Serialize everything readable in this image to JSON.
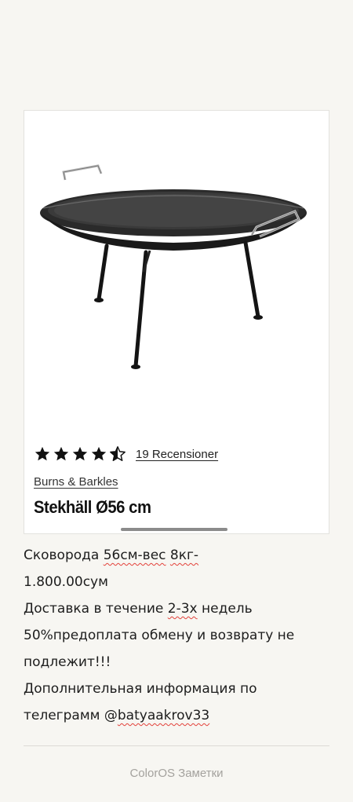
{
  "product_card": {
    "image_icon": "fire-pan-with-legs-image",
    "rating": 4.5,
    "rating_max": 5,
    "review_count_text": "19 Recensioner",
    "brand": "Burns & Barkles",
    "product_name": "Stekhäll Ø56 cm"
  },
  "note": {
    "line1": {
      "pre": "Сковорода ",
      "mark1": "56см-вес",
      "mid": " ",
      "mark2": "8кг-"
    },
    "line2": "1.800.00сум",
    "line3": {
      "pre": "Доставка в течение ",
      "mark": "2-3х",
      "post": " недель"
    },
    "line4": "50%предоплата обмену и возврату не",
    "line5": "подлежит!!!",
    "line6": "Дополнительная информация по",
    "line7": {
      "pre": "телеграмм @",
      "mark": "batyaakrov33"
    }
  },
  "footer": {
    "label": "ColorOS Заметки"
  },
  "colors": {
    "background": "#f7f6f2",
    "spellcheck_underline": "#e3413a",
    "footer_text": "#a4a29e"
  }
}
